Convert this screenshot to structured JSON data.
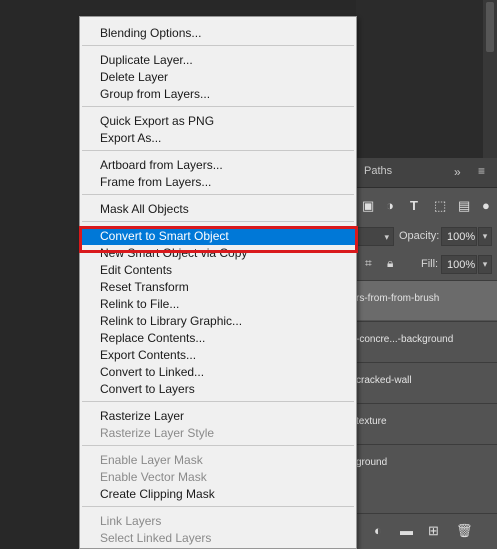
{
  "background_panel": {
    "tab_label": "Paths",
    "tab_icons": [
      "double-chevron-icon",
      "hamburger-menu-icon"
    ],
    "filter_icons": [
      "image-filter-icon",
      "adjustment-filter-icon",
      "type-filter-icon",
      "shape-filter-icon",
      "smart-object-filter-icon",
      "filter-toggle-icon"
    ],
    "opacity_label": "Opacity:",
    "opacity_value": "100%",
    "fill_label": "Fill:",
    "fill_value": "100%",
    "layers": [
      {
        "name": "rs-from-from-brush",
        "selected": true
      },
      {
        "name": "-concre...-background",
        "selected": false
      },
      {
        "name": "cracked-wall",
        "selected": false
      },
      {
        "name": "texture",
        "selected": false
      },
      {
        "name": "ground",
        "selected": false
      }
    ],
    "bottom_icons": [
      "adjustment-layer-icon",
      "folder-icon",
      "new-layer-icon",
      "trash-icon"
    ]
  },
  "context_menu": {
    "items": [
      {
        "label": "Blending Options...",
        "enabled": true
      },
      {
        "sep": true
      },
      {
        "label": "Duplicate Layer...",
        "enabled": true
      },
      {
        "label": "Delete Layer",
        "enabled": true
      },
      {
        "label": "Group from Layers...",
        "enabled": true
      },
      {
        "sep": true
      },
      {
        "label": "Quick Export as PNG",
        "enabled": true
      },
      {
        "label": "Export As...",
        "enabled": true
      },
      {
        "sep": true
      },
      {
        "label": "Artboard from Layers...",
        "enabled": true
      },
      {
        "label": "Frame from Layers...",
        "enabled": true
      },
      {
        "sep": true
      },
      {
        "label": "Mask All Objects",
        "enabled": true
      },
      {
        "sep": true
      },
      {
        "label": "Convert to Smart Object",
        "enabled": true,
        "highlighted": true
      },
      {
        "label": "New Smart Object via Copy",
        "enabled": true
      },
      {
        "label": "Edit Contents",
        "enabled": true
      },
      {
        "label": "Reset Transform",
        "enabled": true
      },
      {
        "label": "Relink to File...",
        "enabled": true
      },
      {
        "label": "Relink to Library Graphic...",
        "enabled": true
      },
      {
        "label": "Replace Contents...",
        "enabled": true
      },
      {
        "label": "Export Contents...",
        "enabled": true
      },
      {
        "label": "Convert to Linked...",
        "enabled": true
      },
      {
        "label": "Convert to Layers",
        "enabled": true
      },
      {
        "sep": true
      },
      {
        "label": "Rasterize Layer",
        "enabled": true
      },
      {
        "label": "Rasterize Layer Style",
        "enabled": false
      },
      {
        "sep": true
      },
      {
        "label": "Enable Layer Mask",
        "enabled": false
      },
      {
        "label": "Enable Vector Mask",
        "enabled": false
      },
      {
        "label": "Create Clipping Mask",
        "enabled": true
      },
      {
        "sep": true
      },
      {
        "label": "Link Layers",
        "enabled": false
      },
      {
        "label": "Select Linked Layers",
        "enabled": false
      }
    ]
  },
  "colors": {
    "highlight": "#0078d7",
    "annotation_frame": "#d9191c"
  }
}
